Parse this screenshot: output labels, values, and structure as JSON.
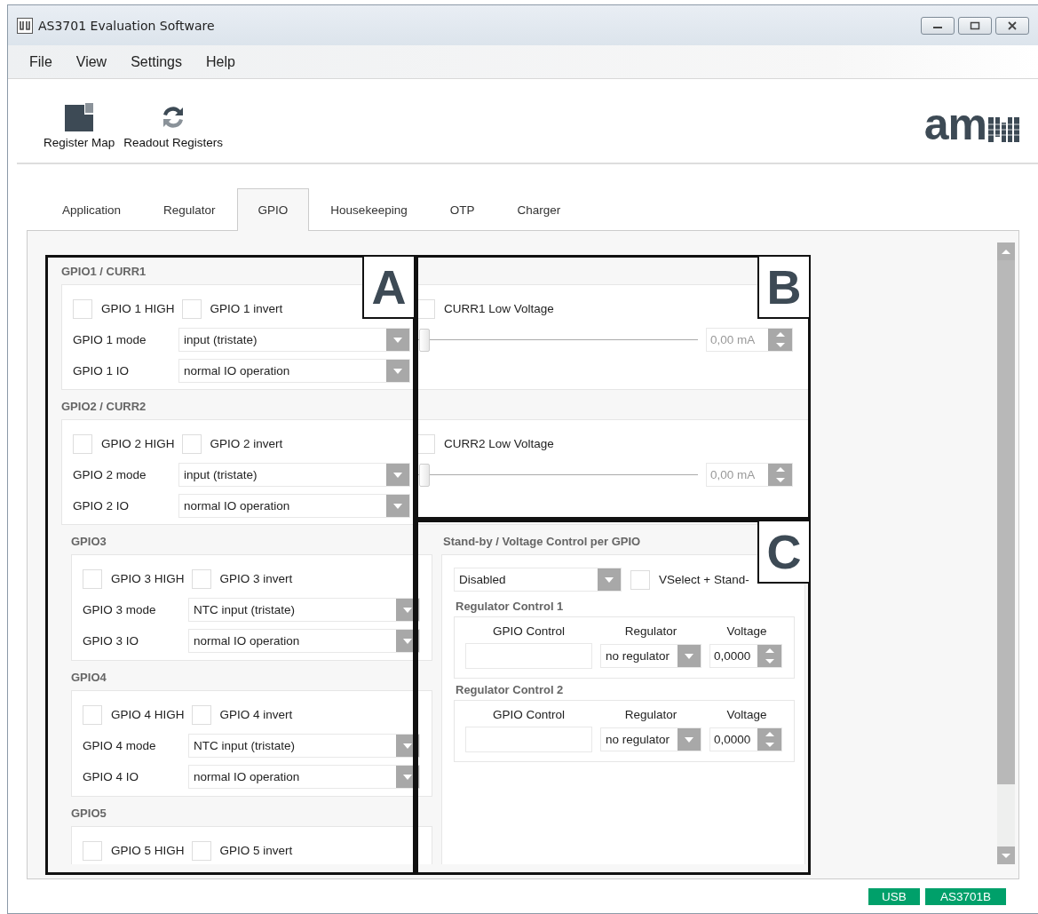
{
  "window": {
    "title": "AS3701 Evaluation Software"
  },
  "menu": [
    "File",
    "View",
    "Settings",
    "Help"
  ],
  "toolbar": [
    {
      "label": "Register Map",
      "kind": "map"
    },
    {
      "label": "Readout Registers",
      "kind": "refresh"
    }
  ],
  "logo": {
    "text": "am"
  },
  "tabs": [
    {
      "label": "Application",
      "selected": false
    },
    {
      "label": "Regulator",
      "selected": false
    },
    {
      "label": "GPIO",
      "selected": true
    },
    {
      "label": "Housekeeping",
      "selected": false
    },
    {
      "label": "OTP",
      "selected": false
    },
    {
      "label": "Charger",
      "selected": false
    }
  ],
  "gpio_wide": [
    {
      "title": "GPIO1 / CURR1",
      "high": {
        "label": "GPIO 1 HIGH",
        "checked": false
      },
      "invert": {
        "label": "GPIO 1 invert",
        "checked": false
      },
      "rows": [
        {
          "label": "GPIO 1 mode",
          "value": "input (tristate)"
        },
        {
          "label": "GPIO 1 IO",
          "value": "normal IO operation"
        }
      ],
      "current": {
        "label": "CURR1 Low Voltage",
        "checked": false,
        "level": 0,
        "reading": "0,00 mA"
      }
    },
    {
      "title": "GPIO2 / CURR2",
      "high": {
        "label": "GPIO 2 HIGH",
        "checked": false
      },
      "invert": {
        "label": "GPIO 2 invert",
        "checked": false
      },
      "rows": [
        {
          "label": "GPIO 2 mode",
          "value": "input (tristate)"
        },
        {
          "label": "GPIO 2 IO",
          "value": "normal IO operation"
        }
      ],
      "current": {
        "label": "CURR2 Low Voltage",
        "checked": false,
        "level": 0,
        "reading": "0,00 mA"
      }
    }
  ],
  "gpio_narrow": [
    {
      "title": "GPIO3",
      "high": {
        "label": "GPIO 3 HIGH",
        "checked": false
      },
      "invert": {
        "label": "GPIO 3 invert",
        "checked": false
      },
      "rows": [
        {
          "label": "GPIO 3 mode",
          "value": "NTC input (tristate)"
        },
        {
          "label": "GPIO 3 IO",
          "value": "normal IO operation"
        }
      ]
    },
    {
      "title": "GPIO4",
      "high": {
        "label": "GPIO 4 HIGH",
        "checked": false
      },
      "invert": {
        "label": "GPIO 4 invert",
        "checked": false
      },
      "rows": [
        {
          "label": "GPIO 4 mode",
          "value": "NTC input (tristate)"
        },
        {
          "label": "GPIO 4 IO",
          "value": "normal IO operation"
        }
      ]
    },
    {
      "title": "GPIO5",
      "high": {
        "label": "GPIO 5 HIGH",
        "checked": false
      },
      "invert": {
        "label": "GPIO 5 invert",
        "checked": false
      }
    }
  ],
  "standby": {
    "title": "Stand-by / Voltage Control per GPIO",
    "mode": "Disabled",
    "vselect": {
      "label": "VSelect + Stand-",
      "checked": false
    },
    "regulator_controls": [
      {
        "title": "Regulator Control 1",
        "headers": [
          "GPIO Control",
          "Regulator",
          "Voltage"
        ],
        "regulator": "no regulator",
        "voltage": "0,0000"
      },
      {
        "title": "Regulator Control 2",
        "headers": [
          "GPIO Control",
          "Regulator",
          "Voltage"
        ],
        "regulator": "no regulator",
        "voltage": "0,0000"
      }
    ]
  },
  "annotations": [
    {
      "label": "A"
    },
    {
      "label": "B"
    },
    {
      "label": "C"
    }
  ],
  "status_bar": [
    "USB",
    "AS3701B"
  ]
}
